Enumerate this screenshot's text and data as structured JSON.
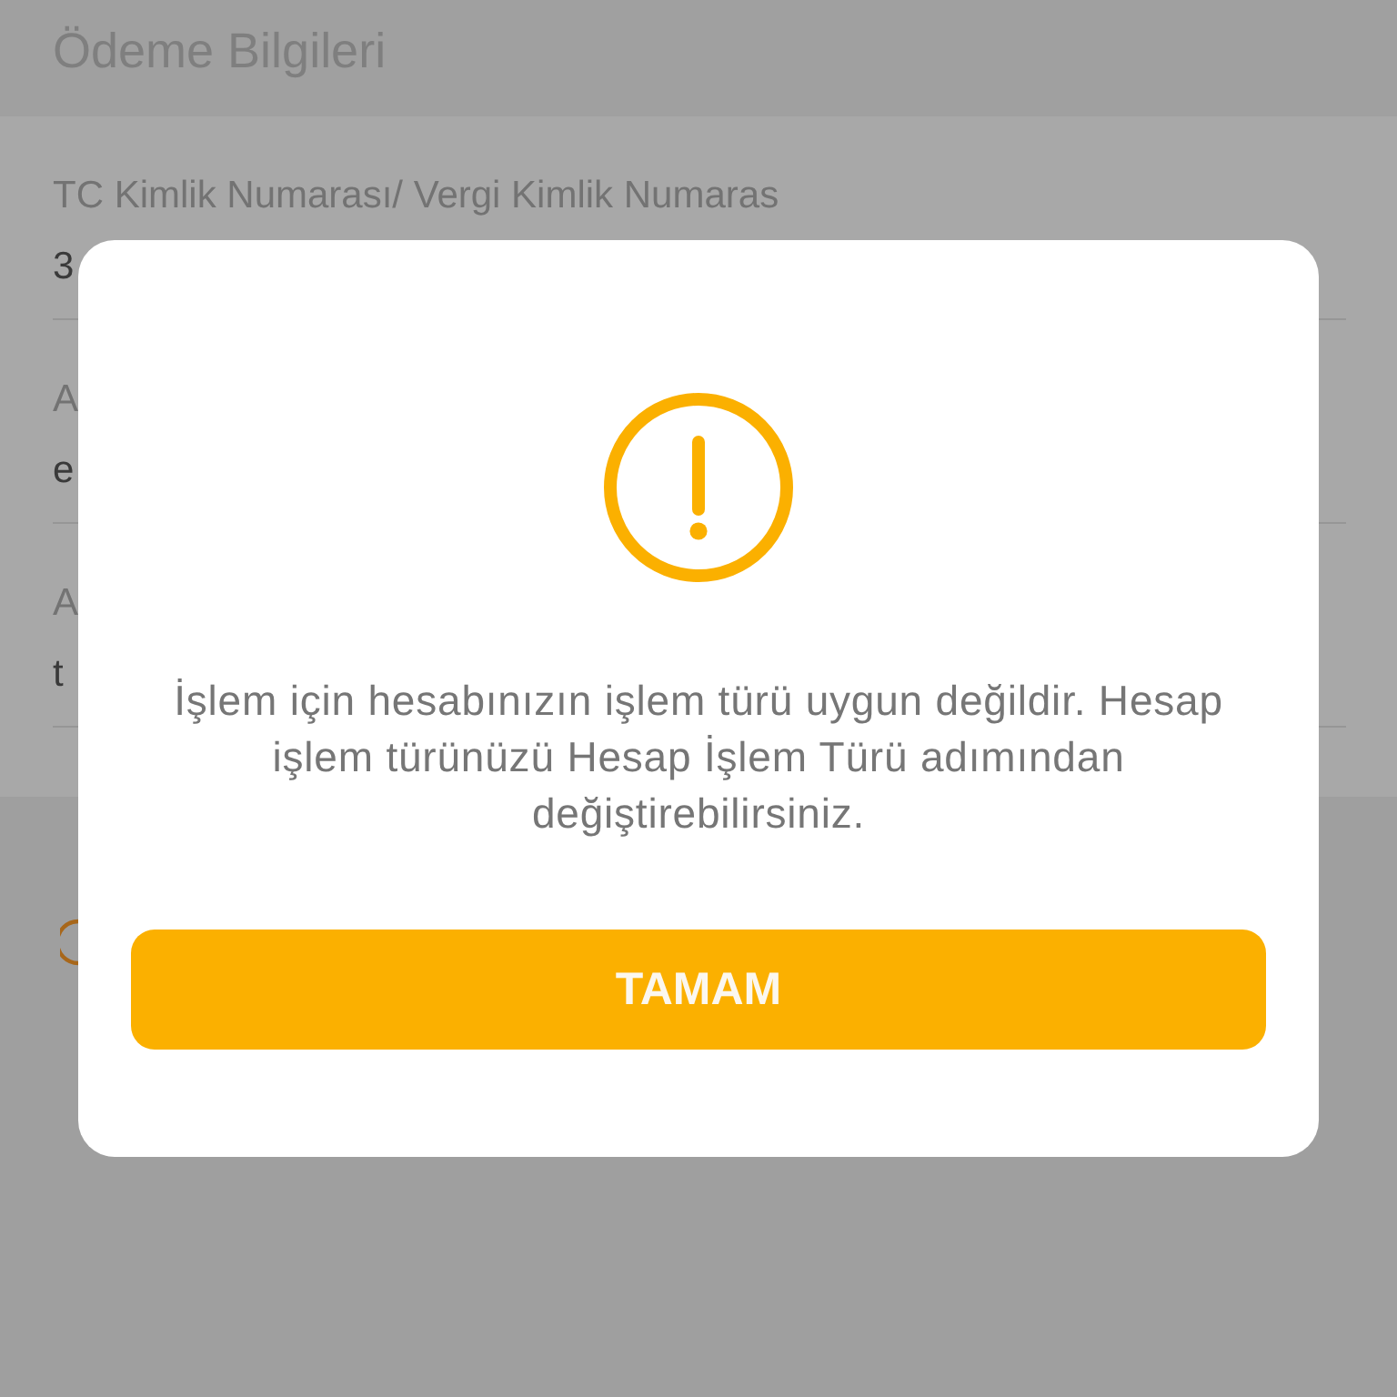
{
  "header": {
    "title": "Ödeme Bilgileri"
  },
  "fields": [
    {
      "label": "TC Kimlik Numarası/ Vergi Kimlik Numaras",
      "value": "3"
    },
    {
      "label": "A",
      "value": "e"
    },
    {
      "label": "A",
      "value": "t"
    }
  ],
  "dialog": {
    "message": "İşlem için hesabınızın işlem türü uygun değildir. Hesap işlem türünüzü Hesap İşlem Türü adımından değiştirebilirsiniz.",
    "button": "TAMAM"
  }
}
